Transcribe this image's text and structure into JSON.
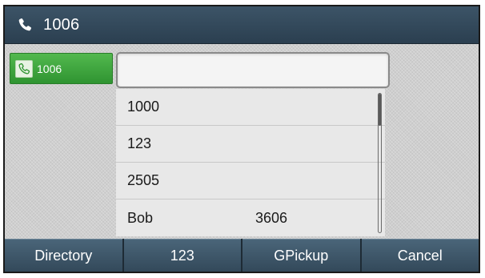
{
  "titlebar": {
    "icon": "phone-handset-icon",
    "title": "1006"
  },
  "line_key": {
    "icon": "phone-handset-icon",
    "label": "1006",
    "color": "#3fa83f"
  },
  "dial_input": {
    "value": "",
    "placeholder": ""
  },
  "suggestions": [
    {
      "name": "1000",
      "number": ""
    },
    {
      "name": "123",
      "number": ""
    },
    {
      "name": "2505",
      "number": ""
    },
    {
      "name": "Bob",
      "number": "3606"
    }
  ],
  "softkeys": [
    {
      "label": "Directory"
    },
    {
      "label": "123"
    },
    {
      "label": "GPickup"
    },
    {
      "label": "Cancel"
    }
  ]
}
